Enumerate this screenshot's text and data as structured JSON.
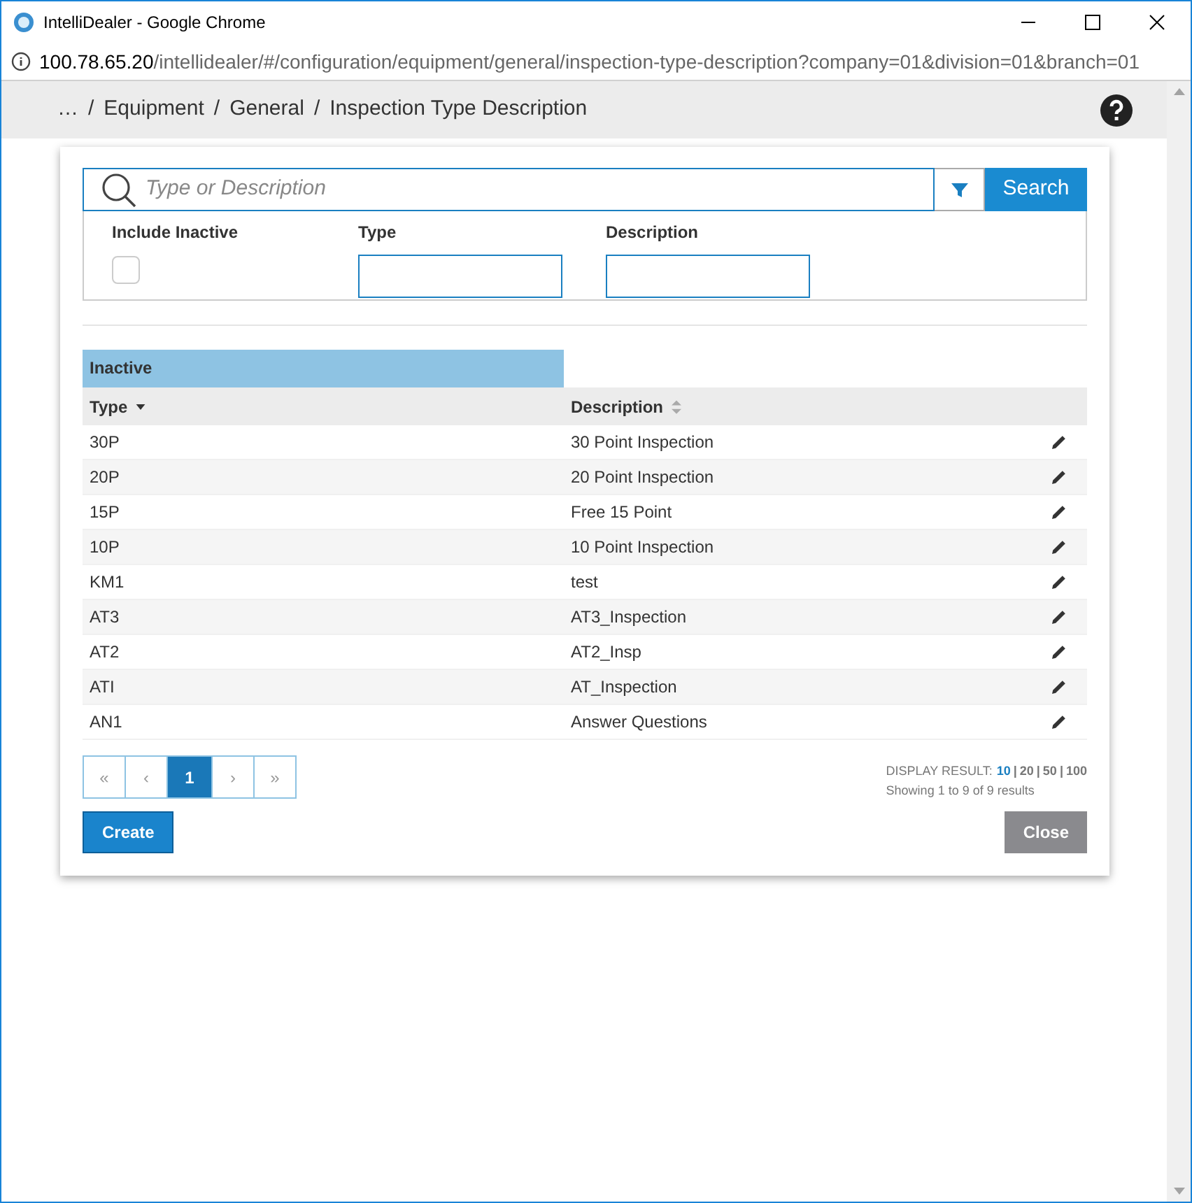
{
  "window": {
    "title": "IntelliDealer - Google Chrome"
  },
  "address_bar": {
    "host": "100.78.65.20",
    "path": "/intellidealer/#/configuration/equipment/general/inspection-type-description?company=01&division=01&branch=01"
  },
  "breadcrumb": [
    {
      "label": "…",
      "separator": "/"
    },
    {
      "label": "Equipment",
      "separator": "/"
    },
    {
      "label": "General",
      "separator": "/"
    },
    {
      "label": "Inspection Type Description"
    }
  ],
  "search": {
    "placeholder": "Type or Description",
    "button": "Search"
  },
  "filters": {
    "include_inactive": {
      "label": "Include Inactive",
      "checked": false
    },
    "type": {
      "label": "Type"
    },
    "description": {
      "label": "Description"
    }
  },
  "table": {
    "group_header": "Inactive",
    "columns": [
      {
        "label": "Type",
        "sorted": true
      },
      {
        "label": "Description",
        "sorted": false
      }
    ],
    "rows": [
      {
        "type": "30P",
        "description": "30 Point Inspection"
      },
      {
        "type": "20P",
        "description": "20 Point Inspection"
      },
      {
        "type": "15P",
        "description": "Free 15 Point"
      },
      {
        "type": "10P",
        "description": "10 Point Inspection"
      },
      {
        "type": "KM1",
        "description": "test"
      },
      {
        "type": "AT3",
        "description": "AT3_Inspection"
      },
      {
        "type": "AT2",
        "description": "AT2_Insp"
      },
      {
        "type": "ATI",
        "description": "AT_Inspection"
      },
      {
        "type": "AN1",
        "description": "Answer Questions"
      }
    ]
  },
  "pagination": {
    "pages": [
      {
        "label": "«",
        "selected": false
      },
      {
        "label": "‹",
        "selected": false
      },
      {
        "label": "1",
        "selected": true
      },
      {
        "label": "›",
        "selected": false
      },
      {
        "label": "»",
        "selected": false
      }
    ]
  },
  "display_result": {
    "label": "DISPLAY RESULT:",
    "sizes": [
      {
        "label": "10",
        "selected": true,
        "separator": "|"
      },
      {
        "label": "20",
        "selected": false,
        "separator": "|"
      },
      {
        "label": "50",
        "selected": false,
        "separator": "|"
      },
      {
        "label": "100",
        "selected": false
      }
    ],
    "summary": "Showing 1 to 9 of 9 results"
  },
  "buttons": {
    "create": "Create",
    "close": "Close"
  }
}
